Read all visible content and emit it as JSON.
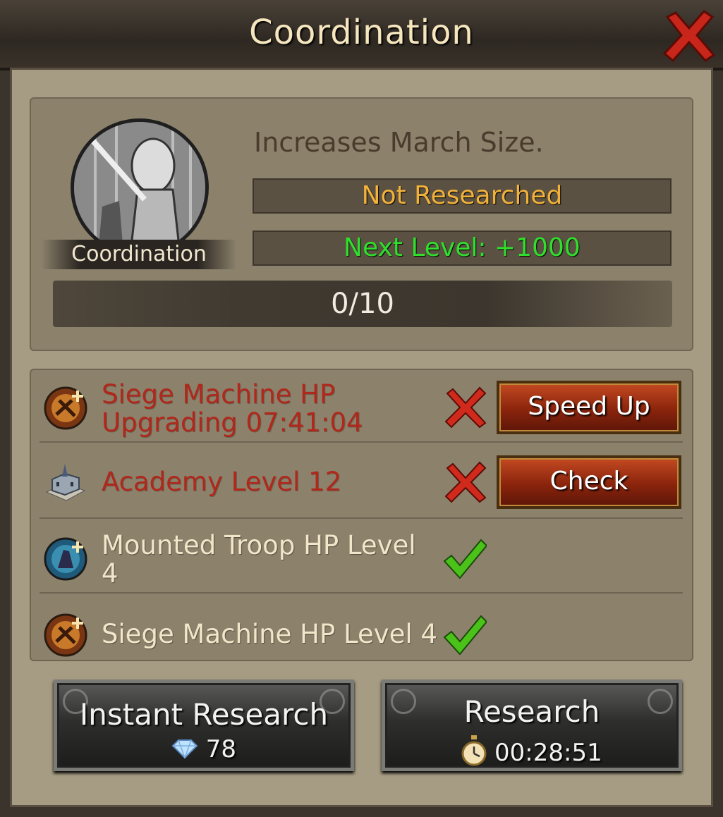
{
  "window": {
    "title": "Coordination"
  },
  "research": {
    "name": "Coordination",
    "description": "Increases March Size.",
    "status": "Not Researched",
    "next_level": "Next Level: +1000",
    "progress_text": "0/10",
    "progress_fraction": 0.0
  },
  "requirements": [
    {
      "line1": "Siege Machine HP",
      "line2": "Upgrading 07:41:04",
      "met": false,
      "icon": "siege-machine-icon",
      "button": "Speed Up"
    },
    {
      "line1": "Academy Level 12",
      "line2": "",
      "met": false,
      "icon": "academy-building-icon",
      "button": "Check"
    },
    {
      "line1": "Mounted Troop HP Level",
      "line2": "4",
      "met": true,
      "icon": "mounted-troop-icon",
      "button": ""
    },
    {
      "line1": "Siege Machine HP Level 4",
      "line2": "",
      "met": true,
      "icon": "siege-machine-icon",
      "button": ""
    }
  ],
  "actions": {
    "instant": {
      "label": "Instant Research",
      "cost": "78",
      "icon": "diamond-icon"
    },
    "research": {
      "label": "Research",
      "time": "00:28:51",
      "icon": "stopwatch-icon"
    }
  },
  "colors": {
    "status": "#f2b23a",
    "next_level": "#2fe02c",
    "unmet": "#b0281c",
    "met": "#f1e6c9"
  }
}
